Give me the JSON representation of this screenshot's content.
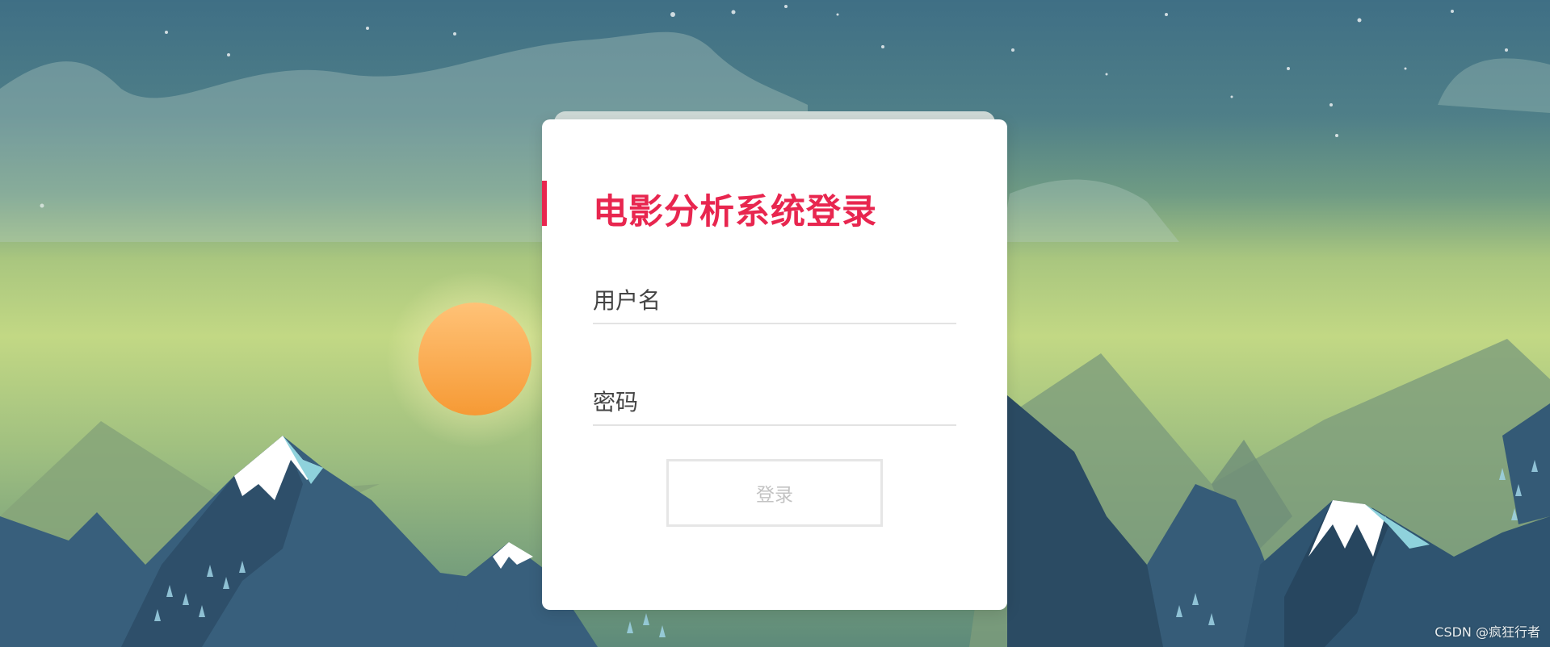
{
  "login": {
    "title": "电影分析系统登录",
    "username_placeholder": "用户名",
    "password_placeholder": "密码",
    "submit_label": "登录"
  },
  "watermark": "CSDN @疯狂行者",
  "colors": {
    "accent": "#e8264f",
    "card_background": "#ffffff",
    "button_text": "#c3c3c3",
    "sun": "#f6a547"
  }
}
